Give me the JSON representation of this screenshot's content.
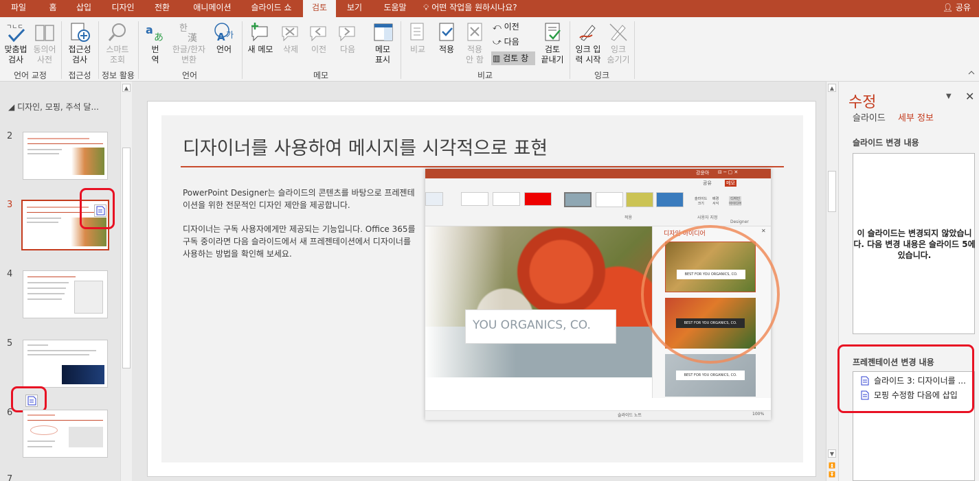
{
  "tabs": [
    {
      "label": "파일"
    },
    {
      "label": "홈"
    },
    {
      "label": "삽입"
    },
    {
      "label": "디자인"
    },
    {
      "label": "전환"
    },
    {
      "label": "애니메이션"
    },
    {
      "label": "슬라이드 쇼"
    },
    {
      "label": "검토"
    },
    {
      "label": "보기"
    },
    {
      "label": "도움말"
    }
  ],
  "tell_me": "어떤 작업을 원하시나요?",
  "share": "공유",
  "ribbon": {
    "spelling": "맞춤법\n검사",
    "thesaurus": "동의어\n사전",
    "group_proofing": "언어 교정",
    "accessibility": "접근성\n검사",
    "group_accessibility": "접근성",
    "smart_lookup": "스마트\n조회",
    "group_insights": "정보 활용",
    "translate": "번\n역",
    "hangul_hanja": "한글/한자\n변환",
    "language": "언어",
    "group_language": "언어",
    "new_comment": "새 메모",
    "delete": "삭제",
    "previous": "이전",
    "next": "다음",
    "show_comments": "메모\n표시",
    "group_comments": "메모",
    "compare": "비교",
    "accept": "적용",
    "reject": "적용\n안 함",
    "prev_small": "이전",
    "next_small": "다음",
    "reviewing_pane": "검토 창",
    "end_review": "검토\n끝내기",
    "group_compare": "비교",
    "start_inking": "잉크 입\n력 시작",
    "hide_ink": "잉크\n숨기기",
    "group_ink": "잉크"
  },
  "thumbnails": {
    "section": "디자인, 모핑, 주석 달...",
    "items": [
      {
        "num": "2"
      },
      {
        "num": "3"
      },
      {
        "num": "4"
      },
      {
        "num": "5"
      },
      {
        "num": "6"
      },
      {
        "num": "7"
      }
    ]
  },
  "slide": {
    "title": "디자이너를 사용하여 메시지를 시각적으로 표현",
    "p1": "PowerPoint Designer는 슬라이드의 콘텐츠를 바탕으로 프레젠테이션을 위한 전문적인 디자인 제안을 제공합니다.",
    "p2": "디자이너는 구독 사용자에게만 제공되는 기능입니다. Office 365를 구독 중이라면 다음 슬라이드에서 새 프레젠테이션에서 디자이너를 사용하는 방법을 확인해 보세요.",
    "banner": "YOU ORGANICS, CO.",
    "app": {
      "user": "강윤아",
      "share": "공유",
      "comments": "메모",
      "apply": "적용",
      "variants": "사용자 지정",
      "designer": "Designer",
      "slide_size": "슬라이드\n크기",
      "bg_format": "배경\n서식",
      "designer_btn": "디자인\n아이디어",
      "pane_title": "디자인 아이디어",
      "card": "BEST FOR YOU ORGANICS, CO.",
      "notes": "슬라이드 노트",
      "zoom": "100%"
    }
  },
  "revisions": {
    "title": "수정",
    "tab_slides": "슬라이드",
    "tab_details": "세부 정보",
    "slide_changes": "슬라이드 변경 내용",
    "no_change": "이 슬라이드는 변경되지 않았습니다. 다음 변경 내용은 슬라이드 5에 있습니다.",
    "pres_changes": "프레젠테이션 변경 내용",
    "items": [
      {
        "label": "슬라이드 3: 디자이너를 ..."
      },
      {
        "label": "모핑 수정함 다음에 삽입"
      }
    ]
  },
  "colors": {
    "accent": "#b7472a",
    "highlight": "#e81123"
  }
}
